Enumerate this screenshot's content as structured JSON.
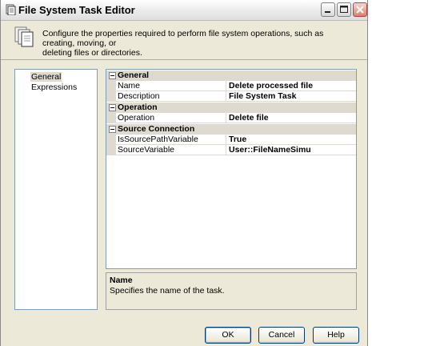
{
  "window": {
    "title": "File System Task Editor",
    "icon": "file-system-task-icon"
  },
  "header": {
    "icon": "copy-files-icon",
    "description_line1": "Configure the properties required to perform file system operations, such as creating, moving, or",
    "description_line2": "deleting files or directories."
  },
  "nav": {
    "items": [
      {
        "label": "General",
        "selected": true
      },
      {
        "label": "Expressions",
        "selected": false
      }
    ]
  },
  "properties": {
    "categories": [
      {
        "label": "General",
        "rows": [
          {
            "name": "Name",
            "value": "Delete processed file"
          },
          {
            "name": "Description",
            "value": "File System Task"
          }
        ]
      },
      {
        "label": "Operation",
        "rows": [
          {
            "name": "Operation",
            "value": "Delete file"
          }
        ]
      },
      {
        "label": "Source Connection",
        "rows": [
          {
            "name": "IsSourcePathVariable",
            "value": "True"
          },
          {
            "name": "SourceVariable",
            "value": "User::FileNameSimu"
          }
        ]
      }
    ]
  },
  "help": {
    "title": "Name",
    "description": "Specifies the name of the task."
  },
  "buttons": {
    "ok": "OK",
    "cancel": "Cancel",
    "help": "Help"
  },
  "colors": {
    "dialog_background": "#ece9d8",
    "category_background": "#dedad0",
    "panel_border": "#7f9db9",
    "close_button": "#d58270"
  }
}
